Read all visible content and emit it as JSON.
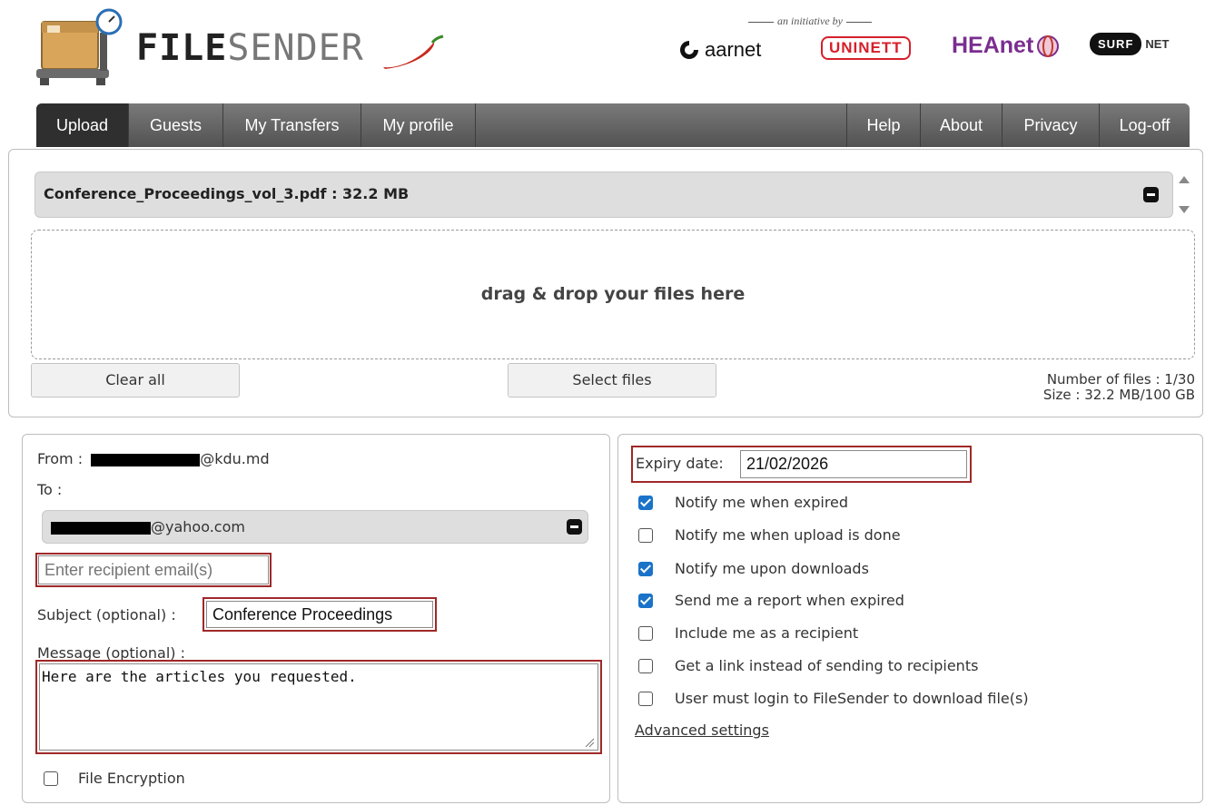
{
  "header": {
    "brand_bold": "FILE",
    "brand_light": "SENDER",
    "initiative": "an initiative by",
    "partners": {
      "aarnet": "aarnet",
      "uninett": "UNINETT",
      "heanet": "HEAnet",
      "surf": "SURF",
      "net": "NET"
    }
  },
  "nav": {
    "upload": "Upload",
    "guests": "Guests",
    "my_transfers": "My Transfers",
    "my_profile": "My profile",
    "help": "Help",
    "about": "About",
    "privacy": "Privacy",
    "logoff": "Log-off"
  },
  "files": {
    "file_entry": "Conference_Proceedings_vol_3.pdf : 32.2 MB",
    "dropzone_text": "drag & drop your files here",
    "clear_all": "Clear all",
    "select_files": "Select files",
    "number_of_files": "Number of files : 1/30",
    "size": "Size : 32.2 MB/100 GB"
  },
  "form": {
    "from_label": "From :",
    "from_domain": "@kdu.md",
    "to_label": "To :",
    "recipient_domain": "@yahoo.com",
    "recipient_placeholder": "Enter recipient email(s)",
    "subject_label": "Subject (optional) :",
    "subject_value": "Conference Proceedings",
    "message_label": "Message (optional) :",
    "message_value": "Here are the articles you requested.",
    "file_encryption": "File Encryption"
  },
  "options": {
    "expiry_label": "Expiry date:",
    "expiry_value": "21/02/2026",
    "items": [
      {
        "label": "Notify me when expired",
        "checked": true
      },
      {
        "label": "Notify me when upload is done",
        "checked": false
      },
      {
        "label": "Notify me upon downloads",
        "checked": true
      },
      {
        "label": "Send me a report when expired",
        "checked": true
      },
      {
        "label": "Include me as a recipient",
        "checked": false
      },
      {
        "label": "Get a link instead of sending to recipients",
        "checked": false
      },
      {
        "label": "User must login to FileSender to download file(s)",
        "checked": false
      }
    ],
    "advanced_settings": "Advanced settings"
  },
  "colors": {
    "nav_dark": "#2f2f2f",
    "nav_gray": "#5e5e5e",
    "highlight_red": "#a02828",
    "checkbox_blue": "#1a73c8"
  }
}
